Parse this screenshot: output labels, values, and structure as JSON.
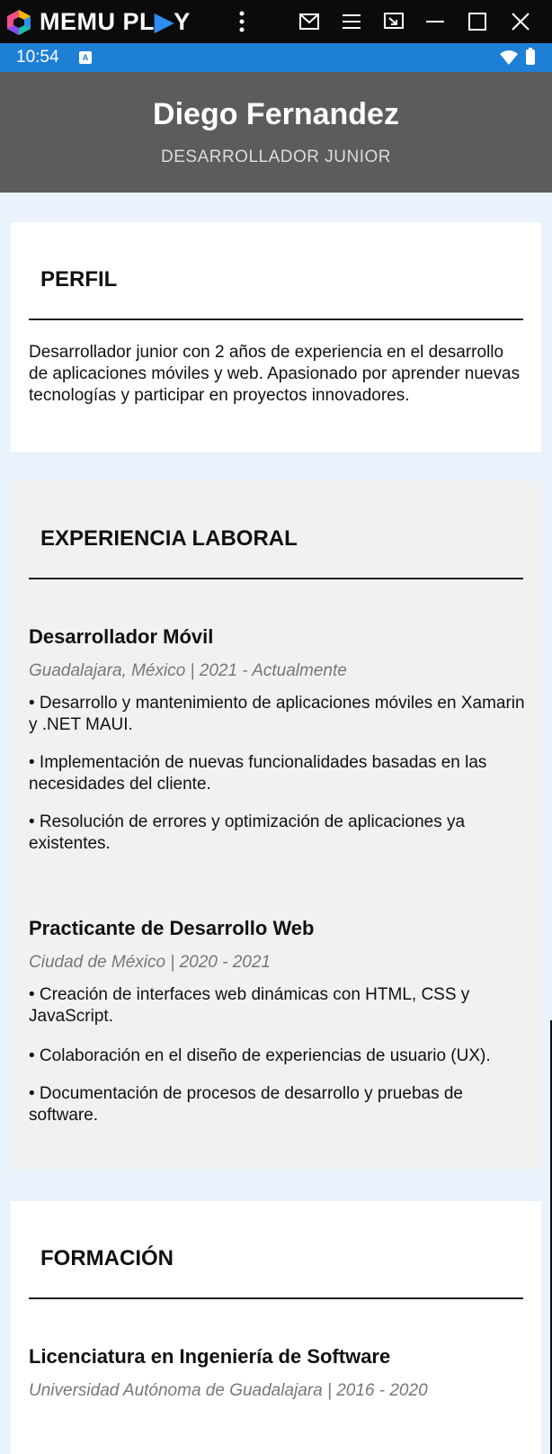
{
  "emulator": {
    "brand_left": "MEMU PL",
    "brand_right": "Y",
    "icons": [
      "more-vert-icon",
      "mail-icon",
      "menu-icon",
      "screen-icon",
      "minimize-icon",
      "maximize-icon",
      "close-icon"
    ]
  },
  "status_bar": {
    "time": "10:54",
    "notification_glyph": "A"
  },
  "header": {
    "name": "Diego Fernandez",
    "role": "DESARROLLADOR JUNIOR"
  },
  "perfil": {
    "title": "PERFIL",
    "text": "Desarrollador junior con 2 años de experiencia en el desarrollo de aplicaciones móviles y web. Apasionado por aprender nuevas tecnologías y participar en proyectos innovadores."
  },
  "experiencia": {
    "title": "EXPERIENCIA LABORAL",
    "jobs": [
      {
        "title": "Desarrollador Móvil",
        "meta": "Guadalajara, México | 2021 - Actualmente",
        "bullets": [
          "• Desarrollo y mantenimiento de aplicaciones móviles en Xamarin y .NET MAUI.",
          "• Implementación de nuevas funcionalidades basadas en las necesidades del cliente.",
          "• Resolución de errores y optimización de aplicaciones ya existentes."
        ]
      },
      {
        "title": "Practicante de Desarrollo Web",
        "meta": "Ciudad de México | 2020 - 2021",
        "bullets": [
          "• Creación de interfaces web dinámicas con HTML, CSS y JavaScript.",
          "• Colaboración en el diseño de experiencias de usuario (UX).",
          "• Documentación de procesos de desarrollo y pruebas de software."
        ]
      }
    ]
  },
  "formacion": {
    "title": "FORMACIÓN",
    "degree": "Licenciatura en Ingeniería de Software",
    "meta": "Universidad Autónoma de Guadalajara | 2016 - 2020"
  },
  "colors": {
    "emulator_bar": "#0b0b0b",
    "status_bar": "#1e7fd6",
    "header": "#5c5c5c",
    "page_bg": "#eaf3fc",
    "card_gray": "#f1f1f1",
    "meta_text": "#777777"
  }
}
